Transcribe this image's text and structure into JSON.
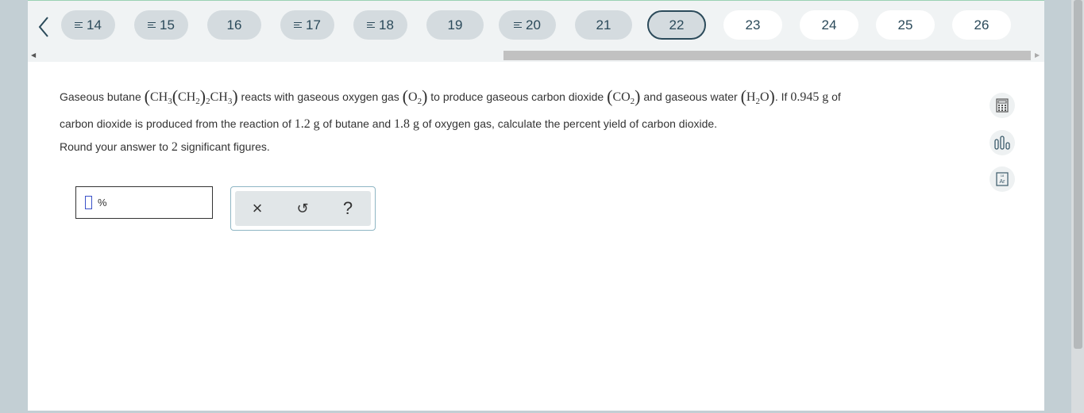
{
  "navigation": {
    "questions": [
      {
        "label": "14",
        "state": "answered"
      },
      {
        "label": "15",
        "state": "answered"
      },
      {
        "label": "16",
        "state": "visited"
      },
      {
        "label": "17",
        "state": "answered"
      },
      {
        "label": "18",
        "state": "answered"
      },
      {
        "label": "19",
        "state": "visited"
      },
      {
        "label": "20",
        "state": "answered"
      },
      {
        "label": "21",
        "state": "visited"
      },
      {
        "label": "22",
        "state": "current"
      },
      {
        "label": "23",
        "state": "future"
      },
      {
        "label": "24",
        "state": "future"
      },
      {
        "label": "25",
        "state": "future"
      },
      {
        "label": "26",
        "state": "future"
      }
    ]
  },
  "question": {
    "t1": "Gaseous butane ",
    "butane_ch3": "CH",
    "sub3": "3",
    "butane_ch2": "CH",
    "sub2": "2",
    "butane_ch3b": "CH",
    "t2": " reacts with gaseous oxygen gas ",
    "o2_o": "O",
    "t3": " to produce gaseous carbon dioxide ",
    "co2_co": "CO",
    "t4": " and gaseous water ",
    "h2o_h": "H",
    "h2o_o": "O",
    "t5": ". If ",
    "co2_mass": "0.945",
    "unit_g": "g",
    "t6": " of",
    "t7": "carbon dioxide is produced from the reaction of ",
    "butane_mass": "1.2",
    "t8": " of butane and ",
    "oxygen_mass": "1.8",
    "t9": " of oxygen gas, calculate the percent yield of carbon dioxide.",
    "round_pre": "Round your answer to ",
    "sig_figs": "2",
    "round_post": " significant figures."
  },
  "answer": {
    "value": "",
    "unit": "%"
  },
  "tools": {
    "clear": "×",
    "undo": "↺",
    "help": "?"
  },
  "side_tools": [
    "calculator-icon",
    "data-chart-icon",
    "periodic-table-icon"
  ],
  "side_tool_text": {
    "periodic_label": "Ar",
    "periodic_number": "18"
  },
  "colors": {
    "accent": "#2b4a5a",
    "cursor": "#3a51c8",
    "panel_border": "#8fb6c4"
  }
}
